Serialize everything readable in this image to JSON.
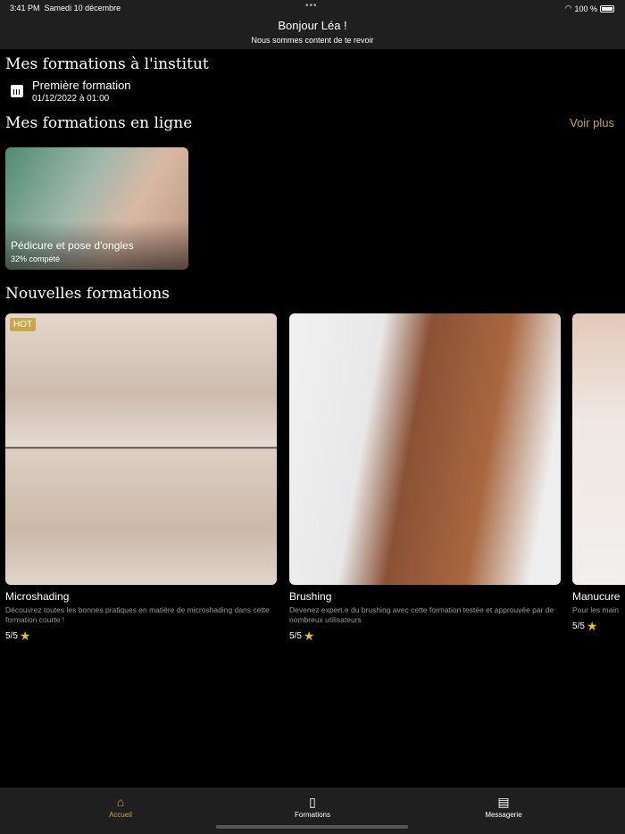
{
  "status": {
    "time": "3:41 PM",
    "date": "Samedi 10 décembre",
    "battery": "100 %"
  },
  "header": {
    "title": "Bonjour Léa !",
    "subtitle": "Nous sommes content de te revoir"
  },
  "institut": {
    "title": "Mes formations à l'institut",
    "items": [
      {
        "name": "Première formation",
        "date": "01/12/2022 à 01:00"
      }
    ]
  },
  "online": {
    "title": "Mes formations en ligne",
    "more": "Voir plus",
    "items": [
      {
        "name": "Pédicure et pose d'ongles",
        "progress": "32% compété",
        "progress_value": 32
      }
    ]
  },
  "new": {
    "title": "Nouvelles formations",
    "items": [
      {
        "badge": "HOT",
        "name": "Microshading",
        "desc": "Découvrez toutes les bonnes pratiques en matière de microshading dans cette formation courte !",
        "rating": "5/5"
      },
      {
        "name": "Brushing",
        "desc": "Devenez expert.e du brushing avec cette formation testée et approuvée par de nombreux utilisateurs",
        "rating": "5/5"
      },
      {
        "name": "Manucure",
        "desc": "Pour les main",
        "rating": "5/5"
      }
    ]
  },
  "tabs": [
    {
      "label": "Accueil",
      "icon": "home-icon",
      "active": true
    },
    {
      "label": "Formations",
      "icon": "book-icon"
    },
    {
      "label": "Messagerie",
      "icon": "message-icon"
    }
  ],
  "colors": {
    "accent": "#c9a648",
    "bar": "#1f1f1f"
  }
}
